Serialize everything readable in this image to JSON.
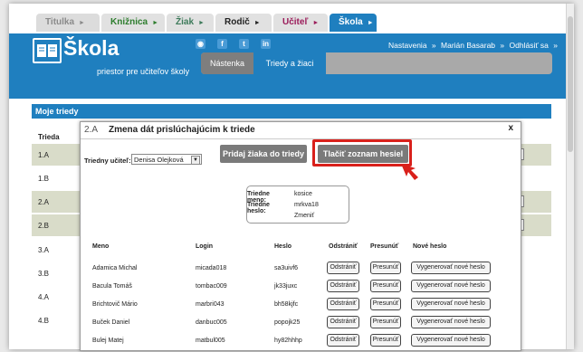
{
  "tabs": [
    {
      "label": "Titulka",
      "arrow": "►"
    },
    {
      "label": "Knižnica",
      "arrow": "►"
    },
    {
      "label": "Žiak",
      "arrow": "►"
    },
    {
      "label": "Rodič",
      "arrow": "►"
    },
    {
      "label": "Učiteľ",
      "arrow": "►"
    },
    {
      "label": "Škola",
      "arrow": "►"
    }
  ],
  "header": {
    "title": "Škola",
    "subtitle": "priestor pre učiteľov školy",
    "links": {
      "settings": "Nastavenia",
      "sep1": "»",
      "user": "Marián Basarab",
      "sep2": "»",
      "logout": "Odhlásiť sa",
      "sep3": "»"
    },
    "social_icons": [
      "rss-icon",
      "facebook-icon",
      "twitter-icon",
      "linkedin-icon"
    ]
  },
  "nav": {
    "board": "Nástenka",
    "classes": "Triedy a žiaci"
  },
  "content": {
    "section_title": "Moje triedy",
    "column_header": "Trieda",
    "classes": [
      "1.A",
      "1.B",
      "2.A",
      "2.B",
      "3.A",
      "3.B",
      "4.A",
      "4.B"
    ],
    "row_button_fragment": "m"
  },
  "modal": {
    "code": "2.A",
    "title": "Zmena dát prislúchajúcim k triede",
    "close": "x",
    "teacher_label": "Triedny učiteľ:",
    "teacher_value": "Denisa Olejková",
    "add_student_button": "Pridaj žiaka do triedy",
    "print_passwords_button": "Tlačiť zoznam hesiel",
    "class_name_label": "Triedne meno:",
    "class_name_value": "kosice",
    "class_password_label": "Triedne heslo:",
    "class_password_value": "mrkva18",
    "change_link": "Zmeniť",
    "columns": {
      "name": "Meno",
      "login": "Login",
      "password": "Heslo",
      "remove": "Odstrániť",
      "move": "Presunúť",
      "new_password": "Nové heslo"
    },
    "students": [
      {
        "name": "Adamica Michal",
        "login": "micada018",
        "password": "sa3uivf6"
      },
      {
        "name": "Bacula Tomáš",
        "login": "tombac009",
        "password": "jk33juxc"
      },
      {
        "name": "Brichtovič Mário",
        "login": "marbri043",
        "password": "bh58kjfc"
      },
      {
        "name": "Buček Daniel",
        "login": "danbuc005",
        "password": "popojk25"
      },
      {
        "name": "Bulej Matej",
        "login": "matbul005",
        "password": "hy82hhhp"
      }
    ],
    "remove_button": "Odstrániť",
    "move_button": "Presunúť",
    "generate_button": "Vygenerovať nové heslo"
  },
  "colors": {
    "brand_blue": "#1f7fbf",
    "highlight_red": "#d9201b",
    "row_shade": "#d9dcc9"
  }
}
